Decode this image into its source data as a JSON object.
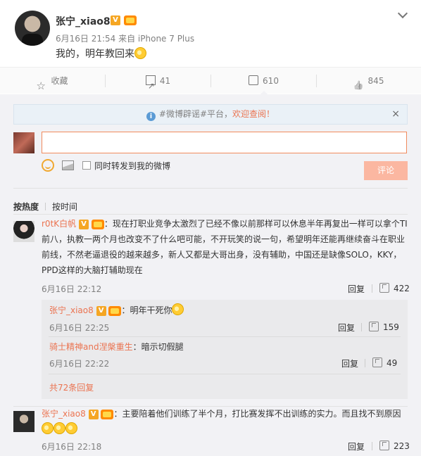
{
  "post": {
    "author": "张宁_xiao8",
    "meta": "6月16日 21:54 来自 iPhone 7 Plus",
    "text": "我的，明年教回来"
  },
  "actions": {
    "favorite": "收藏",
    "share_count": "41",
    "comment_count": "610",
    "like_count": "845"
  },
  "notice": {
    "prefix": "#微博辟谣#平台，",
    "highlight": "欢迎查阅！",
    "close": "×"
  },
  "composer": {
    "input_value": "",
    "repost_label": "同时转发到我的微博",
    "submit_label": "评论"
  },
  "sort": {
    "hot": "按热度",
    "time": "按时间"
  },
  "comments": [
    {
      "user": "r0tK白帆",
      "lines": [
        "：现在打职业竞争太激烈了已经不像以前那样可以休息半年再复出一样可以拿个TI",
        "前八，执教一两个月也改变不了什么吧可能，不开玩笑的说一句，希望明年还能再继续奋斗在职业",
        "前线，不然老逼退役的越来越多，新人又都是大哥出身，没有辅助，中国还是缺像SOLO，KKY，",
        "PPD这样的大脑打辅助现在"
      ],
      "time": "6月16日 22:12",
      "reply": "回复",
      "likes": "422",
      "sub_replies": [
        {
          "user": "张宁_xiao8",
          "text": "：明年干死你",
          "time": "6月16日 22:25",
          "reply": "回复",
          "likes": "159"
        },
        {
          "user": "骑士精神and涅槃重生",
          "text": "：暗示切假腿",
          "time": "6月16日 22:22",
          "reply": "回复",
          "likes": "49"
        }
      ],
      "more_replies": "共72条回复"
    },
    {
      "user": "张宁_xiao8",
      "lines": [
        "：主要陪着他们训练了半个月，打比赛发挥不出训练的实力。而且找不到原因"
      ],
      "time": "6月16日 22:18",
      "reply": "回复",
      "likes": "223"
    }
  ],
  "colors": {
    "accent": "#eb7350",
    "panel_bg": "#f2f2f5",
    "notice_bg": "#eaf1f7",
    "submit_bg": "#fbb7a1"
  }
}
